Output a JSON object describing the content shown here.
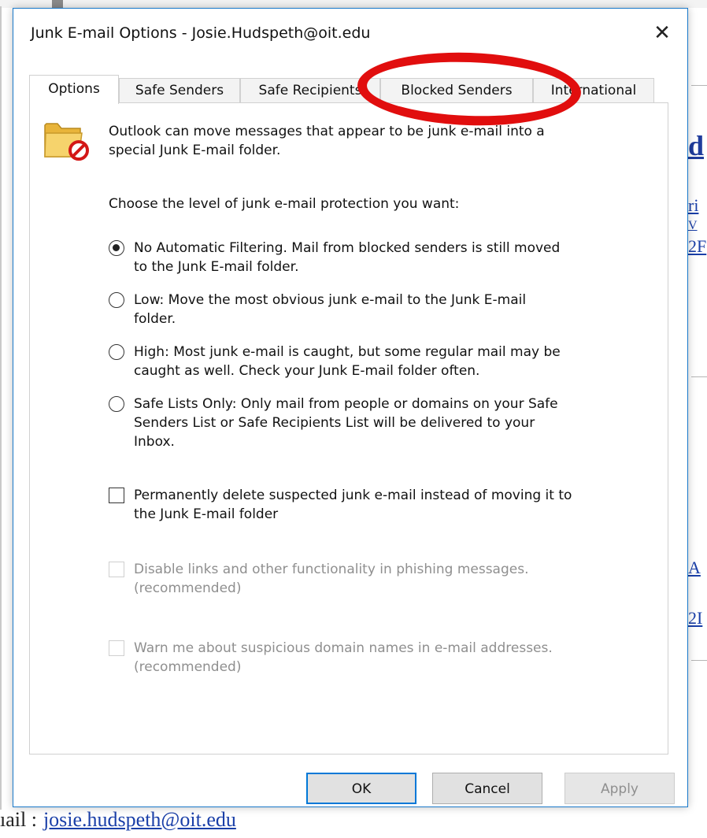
{
  "background": {
    "snippets": [
      "d",
      "ri",
      "V",
      "2F",
      "A",
      "2I"
    ],
    "bottom_label": "ıail :",
    "bottom_email": "josie.hudspeth@oit.edu"
  },
  "dialog": {
    "title": "Junk E-mail Options - Josie.Hudspeth@oit.edu",
    "close_glyph": "✕",
    "tabs": [
      {
        "label": "Options",
        "active": true
      },
      {
        "label": "Safe Senders"
      },
      {
        "label": "Safe Recipients"
      },
      {
        "label": "Blocked Senders"
      },
      {
        "label": "International"
      }
    ],
    "intro": {
      "line1": "Outlook can move messages that appear to be junk e-mail into a",
      "line2": "special Junk E-mail folder."
    },
    "level_prompt": "Choose the level of junk e-mail protection you want:",
    "levels": [
      {
        "line1": "No Automatic Filtering. Mail from blocked senders is still moved",
        "line2": "to the Junk E-mail folder.",
        "selected": true
      },
      {
        "line1": "Low: Move the most obvious junk e-mail to the Junk E-mail",
        "line2": "folder."
      },
      {
        "line1": "High: Most junk e-mail is caught, but some regular mail may be",
        "line2": "caught as well. Check your Junk E-mail folder often."
      },
      {
        "line1": "Safe Lists Only: Only mail from people or domains on your Safe",
        "line2": "Senders List or Safe Recipients List will be delivered to your",
        "line3": "Inbox."
      }
    ],
    "checkboxes": {
      "permanent_delete": {
        "line1": "Permanently delete suspected junk e-mail instead of moving it to",
        "line2": "the Junk E-mail folder",
        "checked": false
      },
      "disable_links": {
        "line1": "Disable links and other functionality in phishing messages.",
        "line2": "(recommended)",
        "enabled": false
      },
      "warn_domains": {
        "line1": "Warn me about suspicious domain names in e-mail addresses.",
        "line2": "(recommended)",
        "enabled": false
      }
    },
    "buttons": {
      "ok": "OK",
      "cancel": "Cancel",
      "apply": "Apply"
    }
  },
  "annotation": {
    "color": "#e10e0e",
    "target": "Blocked Senders"
  },
  "colors": {
    "accent": "#0078d7",
    "dialog_border": "#1979ca",
    "link": "#1a3fa8"
  }
}
